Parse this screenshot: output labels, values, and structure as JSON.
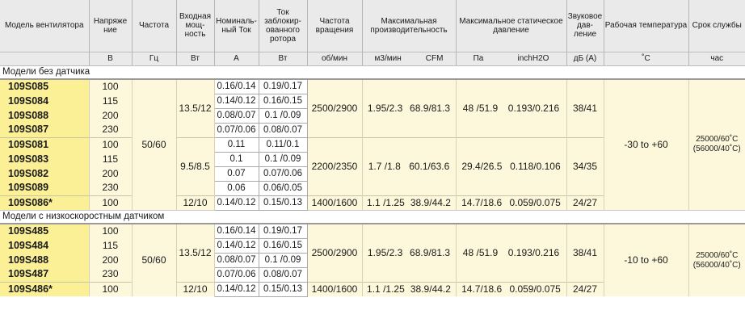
{
  "headers": {
    "model": "Модель вентилятора",
    "voltage": "Напряже ние",
    "frequency": "Частота",
    "input_power": "Входная мощ- ность",
    "rated_current": "Номиналь- ный Ток",
    "locked_current": "Ток заблокир- ованного ротора",
    "speed": "Частота вращения",
    "max_flow": "Максимальная производительность",
    "max_pressure": "Максимальное статическое давление",
    "noise": "Звуковое дав- ление",
    "temp": "Рабочая температура",
    "life": "Срок службы"
  },
  "units": {
    "voltage": "В",
    "frequency": "Гц",
    "input_power": "Вт",
    "rated_current": "А",
    "locked_current": "Вт",
    "speed": "об/мин",
    "flow_m3": "м3/мин",
    "flow_cfm": "CFM",
    "pressure_pa": "Па",
    "pressure_inh2o": "inchH2O",
    "noise": "дБ (А)",
    "temp": "˚С",
    "life": "час"
  },
  "sections": [
    {
      "title": "Модели без датчика",
      "frequency": "50/60",
      "temp": "-30 to +60",
      "life_line1": "25000/60˚C",
      "life_line2": "(56000/40˚C)",
      "groups": [
        {
          "power": "13.5/12",
          "speed": "2500/2900",
          "flow_m3": "1.95/2.3",
          "flow_cfm": "68.9/81.3",
          "pressure_pa": "48 /51.9",
          "pressure_inh2o": "0.193/0.216",
          "noise": "38/41",
          "rows": [
            {
              "model": "109S085",
              "voltage": "100",
              "rated": "0.16/0.14",
              "locked": "0.19/0.17"
            },
            {
              "model": "109S084",
              "voltage": "115",
              "rated": "0.14/0.12",
              "locked": "0.16/0.15"
            },
            {
              "model": "109S088",
              "voltage": "200",
              "rated": "0.08/0.07",
              "locked": "0.1 /0.09"
            },
            {
              "model": "109S087",
              "voltage": "230",
              "rated": "0.07/0.06",
              "locked": "0.08/0.07"
            }
          ]
        },
        {
          "power": "9.5/8.5",
          "speed": "2200/2350",
          "flow_m3": "1.7 /1.8",
          "flow_cfm": "60.1/63.6",
          "pressure_pa": "29.4/26.5",
          "pressure_inh2o": "0.118/0.106",
          "noise": "34/35",
          "rows": [
            {
              "model": "109S081",
              "voltage": "100",
              "rated": "0.11",
              "locked": "0.11/0.1"
            },
            {
              "model": "109S083",
              "voltage": "115",
              "rated": "0.1",
              "locked": "0.1 /0.09"
            },
            {
              "model": "109S082",
              "voltage": "200",
              "rated": "0.07",
              "locked": "0.07/0.06"
            },
            {
              "model": "109S089",
              "voltage": "230",
              "rated": "0.06",
              "locked": "0.06/0.05"
            }
          ]
        },
        {
          "power": "12/10",
          "speed": "1400/1600",
          "flow_m3": "1.1 /1.25",
          "flow_cfm": "38.9/44.2",
          "pressure_pa": "14.7/18.6",
          "pressure_inh2o": "0.059/0.075",
          "noise": "24/27",
          "rows": [
            {
              "model": "109S086*",
              "voltage": "100",
              "rated": "0.14/0.12",
              "locked": "0.15/0.13"
            }
          ]
        }
      ]
    },
    {
      "title": "Модели с низкоскоростным датчиком",
      "frequency": "50/60",
      "temp": "-10 to +60",
      "life_line1": "25000/60˚C",
      "life_line2": "(56000/40˚C)",
      "groups": [
        {
          "power": "13.5/12",
          "speed": "2500/2900",
          "flow_m3": "1.95/2.3",
          "flow_cfm": "68.9/81.3",
          "pressure_pa": "48 /51.9",
          "pressure_inh2o": "0.193/0.216",
          "noise": "38/41",
          "rows": [
            {
              "model": "109S485",
              "voltage": "100",
              "rated": "0.16/0.14",
              "locked": "0.19/0.17"
            },
            {
              "model": "109S484",
              "voltage": "115",
              "rated": "0.14/0.12",
              "locked": "0.16/0.15"
            },
            {
              "model": "109S488",
              "voltage": "200",
              "rated": "0.08/0.07",
              "locked": "0.1 /0.09"
            },
            {
              "model": "109S487",
              "voltage": "230",
              "rated": "0.07/0.06",
              "locked": "0.08/0.07"
            }
          ]
        },
        {
          "power": "12/10",
          "speed": "1400/1600",
          "flow_m3": "1.1 /1.25",
          "flow_cfm": "38.9/44.2",
          "pressure_pa": "14.7/18.6",
          "pressure_inh2o": "0.059/0.075",
          "noise": "24/27",
          "rows": [
            {
              "model": "109S486*",
              "voltage": "100",
              "rated": "0.14/0.12",
              "locked": "0.15/0.13"
            }
          ]
        }
      ]
    }
  ]
}
